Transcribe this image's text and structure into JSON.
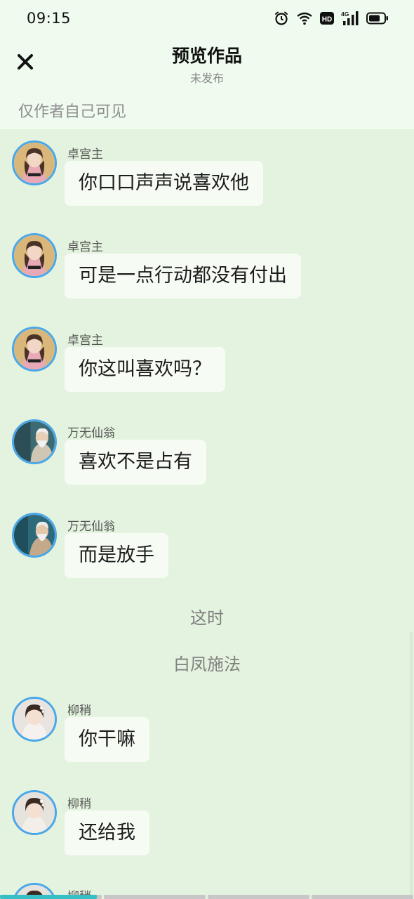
{
  "status_bar": {
    "time": "09:15",
    "icons": [
      "alarm-icon",
      "wifi-icon",
      "hd-icon",
      "signal-4g-icon",
      "battery-icon"
    ],
    "network_label": "4G",
    "hd_label": "HD"
  },
  "header": {
    "title": "预览作品",
    "subtitle": "未发布",
    "close_icon": "close-icon"
  },
  "visibility_note": "仅作者自己可见",
  "colors": {
    "top_bg": "#effbef",
    "chat_bg": "#e4f3df",
    "bubble_bg": "#f6fbf4",
    "avatar_border": "#4aa7e8",
    "progress_fill": "#36c0c6"
  },
  "messages": [
    {
      "type": "chat",
      "sender": "卓宫主",
      "text": "你口口声声说喜欢他"
    },
    {
      "type": "chat",
      "sender": "卓宫主",
      "text": "可是一点行动都没有付出"
    },
    {
      "type": "chat",
      "sender": "卓宫主",
      "text": "你这叫喜欢吗？"
    },
    {
      "type": "chat",
      "sender": "万无仙翁",
      "text": "喜欢不是占有"
    },
    {
      "type": "chat",
      "sender": "万无仙翁",
      "text": "而是放手"
    },
    {
      "type": "narration",
      "text": "这时"
    },
    {
      "type": "narration",
      "text": "白凤施法"
    },
    {
      "type": "chat",
      "sender": "柳稍",
      "text": "你干嘛"
    },
    {
      "type": "chat",
      "sender": "柳稍",
      "text": "还给我"
    },
    {
      "type": "chat",
      "sender": "柳稍",
      "text": ""
    }
  ],
  "progress": {
    "segments": 4,
    "current_segment_fill": 0.95
  }
}
